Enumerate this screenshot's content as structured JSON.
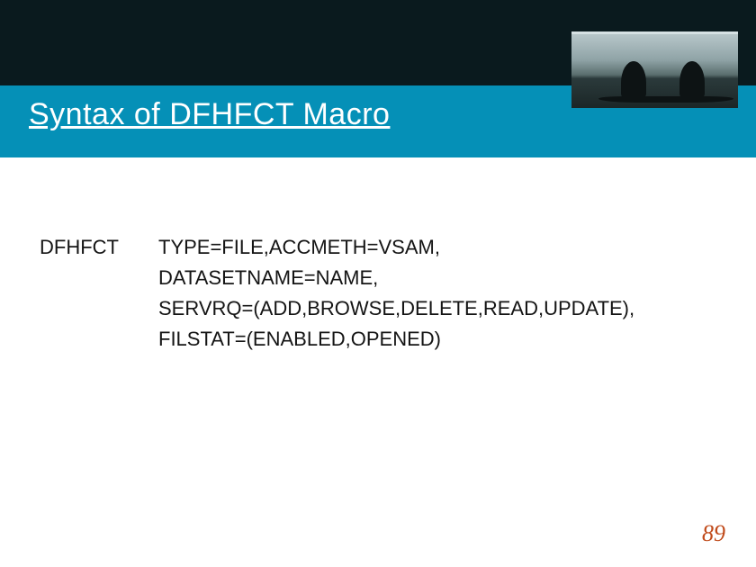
{
  "header": {
    "title": "Syntax of DFHFCT Macro"
  },
  "macro": {
    "label": "DFHFCT",
    "line1": "TYPE=FILE,ACCMETH=VSAM,",
    "line2": "DATASETNAME=NAME,",
    "line3": "SERVRQ=(ADD,BROWSE,DELETE,READ,UPDATE),",
    "line4": "FILSTAT=(ENABLED,OPENED)"
  },
  "page_number": "89"
}
